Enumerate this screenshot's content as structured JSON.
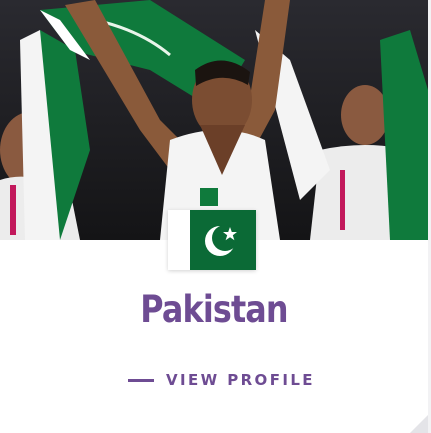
{
  "card": {
    "photo_alt": "",
    "country_name": "Pakistan",
    "profile_link_label": "VIEW PROFILE",
    "flag_icon": "pakistan-flag-icon"
  },
  "colors": {
    "accent": "#6e4c93",
    "flag_green": "#0b6a36",
    "card_bg": "#ffffff"
  }
}
